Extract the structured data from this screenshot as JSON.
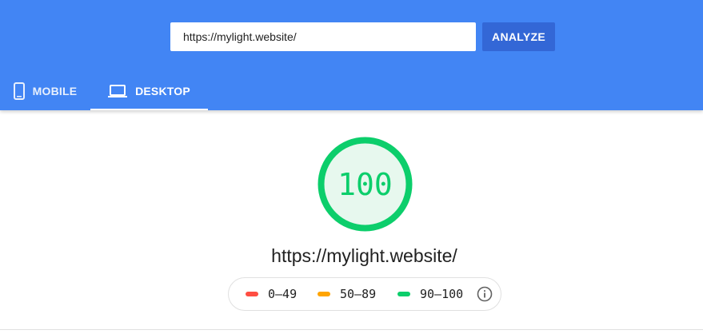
{
  "search": {
    "url_value": "https://mylight.website/",
    "analyze_label": "ANALYZE"
  },
  "tabs": [
    {
      "label": "MOBILE",
      "icon": "smartphone-icon",
      "selected": false
    },
    {
      "label": "DESKTOP",
      "icon": "laptop-icon",
      "selected": true
    }
  ],
  "result": {
    "score": "100",
    "score_fraction": 1.0,
    "score_color": "#0cce6b",
    "tested_url": "https://mylight.website/"
  },
  "legend": {
    "items": [
      {
        "label": "0–49",
        "color": "#ff4e42"
      },
      {
        "label": "50–89",
        "color": "#ffa400"
      },
      {
        "label": "90–100",
        "color": "#0cce6b"
      }
    ],
    "info_icon": "info-icon"
  },
  "colors": {
    "header_bg": "#4285f4",
    "analyze_bg": "#3367d6"
  }
}
